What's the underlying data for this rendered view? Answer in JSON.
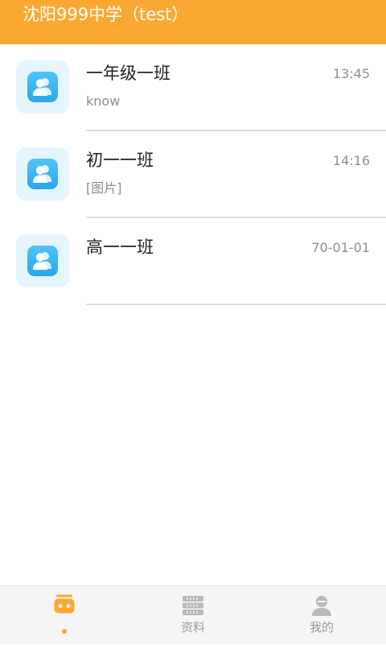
{
  "header": {
    "title": "沈阳999中学（test）"
  },
  "chats": [
    {
      "title": "一年级一班",
      "time": "13:45",
      "last_message": "know",
      "avatar_icon": "group-icon"
    },
    {
      "title": "初一一班",
      "time": "14:16",
      "last_message": "[图片]",
      "avatar_icon": "group-icon"
    },
    {
      "title": "高一一班",
      "time": "70-01-01",
      "last_message": "",
      "avatar_icon": "group-icon"
    }
  ],
  "tabbar": {
    "tabs": [
      {
        "label": "",
        "icon": "chat-icon",
        "active": true
      },
      {
        "label": "资料",
        "icon": "files-icon",
        "active": false
      },
      {
        "label": "我的",
        "icon": "profile-icon",
        "active": false
      }
    ]
  },
  "colors": {
    "accent": "#F9A932",
    "avatar_tile": "#E5F5FD",
    "avatar_icon": "#2AA5EC",
    "inactive_tab": "#B9B9B9"
  }
}
